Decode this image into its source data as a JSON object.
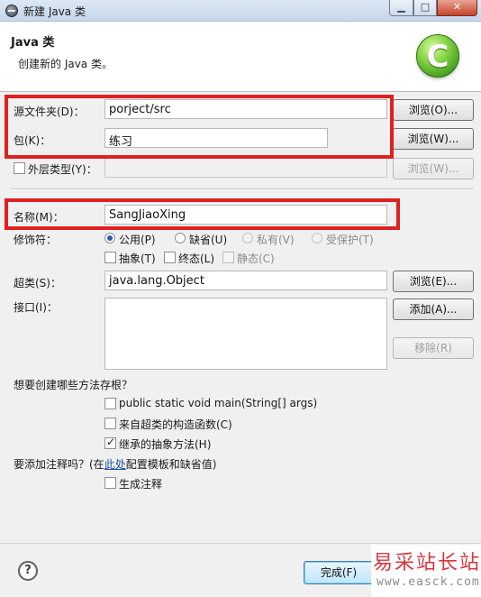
{
  "window": {
    "title": "新建 Java 类",
    "minimize_glyph": "▁",
    "maximize_glyph": "□",
    "close_glyph": "✕"
  },
  "header": {
    "title": "Java 类",
    "description": "创建新的 Java 类。",
    "logo_letter": "C",
    "logo_icon": "new-class-icon"
  },
  "form": {
    "source_folder": {
      "label": "源文件夹(D)：",
      "value": "porject/src",
      "browse_label": "浏览(O)..."
    },
    "package": {
      "label": "包(K)：",
      "value": "练习",
      "browse_label": "浏览(W)..."
    },
    "enclosing_type": {
      "label": "外层类型(Y)：",
      "value": "",
      "checked": false,
      "browse_label": "浏览(W)..."
    },
    "name": {
      "label": "名称(M)：",
      "value": "SangJiaoXing"
    },
    "modifiers": {
      "label": "修饰符：",
      "access": [
        {
          "label": "公用(P)",
          "checked": true,
          "enabled": true
        },
        {
          "label": "缺省(U)",
          "checked": false,
          "enabled": true
        },
        {
          "label": "私有(V)",
          "checked": false,
          "enabled": false
        },
        {
          "label": "受保护(T)",
          "checked": false,
          "enabled": false
        }
      ],
      "other": [
        {
          "label": "抽象(T)",
          "checked": false,
          "enabled": true
        },
        {
          "label": "终态(L)",
          "checked": false,
          "enabled": true
        },
        {
          "label": "静态(C)",
          "checked": false,
          "enabled": false
        }
      ]
    },
    "superclass": {
      "label": "超类(S)：",
      "value": "java.lang.Object",
      "browse_label": "浏览(E)..."
    },
    "interfaces": {
      "label": "接口(I)：",
      "add_label": "添加(A)...",
      "remove_label": "移除(R)"
    },
    "stubs": {
      "question": "想要创建哪些方法存根？",
      "options": [
        {
          "label": "public static void main(String[] args)",
          "checked": false
        },
        {
          "label": "来自超类的构造函数(C)",
          "checked": false
        },
        {
          "label": "继承的抽象方法(H)",
          "checked": true
        }
      ]
    },
    "comments": {
      "question_prefix": "要添加注释吗？(在",
      "link_text": "此处",
      "question_suffix": "配置模板和缺省值)",
      "generate_label": "生成注释",
      "generate_checked": false
    }
  },
  "footer": {
    "help_glyph": "?",
    "finish_label": "完成(F)"
  },
  "watermark": {
    "chinese": "易采站长站",
    "url": "www.easck.com"
  },
  "colors": {
    "highlight_box": "#e0201f",
    "logo_green": "#3f9b1a",
    "link_blue": "#1a4fa0"
  }
}
